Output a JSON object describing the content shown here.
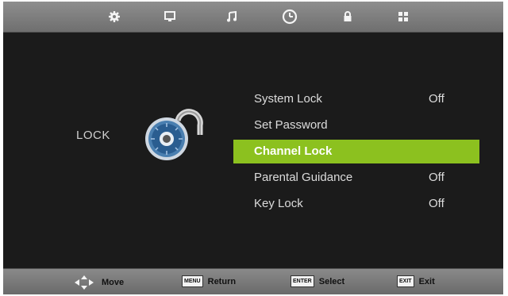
{
  "tabs": [
    {
      "icon": "gear-icon"
    },
    {
      "icon": "monitor-icon"
    },
    {
      "icon": "music-icon"
    },
    {
      "icon": "clock-icon",
      "active": true
    },
    {
      "icon": "lock-tab-icon"
    },
    {
      "icon": "grid-icon"
    }
  ],
  "section": {
    "label": "LOCK",
    "illustration": "padlock-icon"
  },
  "menu": [
    {
      "label": "System Lock",
      "value": "Off"
    },
    {
      "label": "Set Password",
      "value": ""
    },
    {
      "label": "Channel Lock",
      "value": "",
      "selected": true
    },
    {
      "label": "Parental Guidance",
      "value": "Off"
    },
    {
      "label": "Key Lock",
      "value": "Off"
    }
  ],
  "hints": {
    "move": {
      "label": "Move",
      "icon": "dpad-icon"
    },
    "return": {
      "key": "MENU",
      "label": "Return"
    },
    "select": {
      "key": "ENTER",
      "label": "Select"
    },
    "exit": {
      "key": "EXIT",
      "label": "Exit"
    }
  },
  "colors": {
    "highlight": "#8cc11f",
    "background": "#1b1b1b",
    "bar": "#7c7c7c"
  }
}
